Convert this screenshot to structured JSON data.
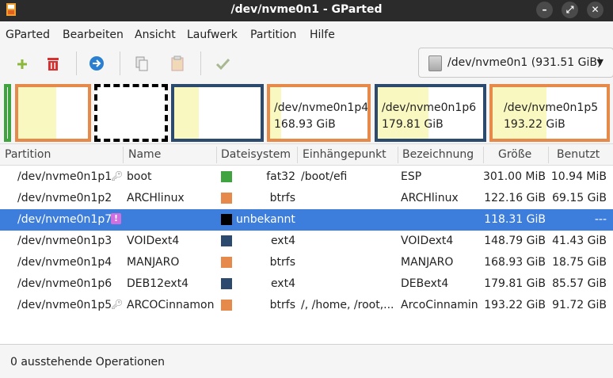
{
  "window": {
    "title": "/dev/nvme0n1 - GParted"
  },
  "menu": [
    "GParted",
    "Bearbeiten",
    "Ansicht",
    "Laufwerk",
    "Partition",
    "Hilfe"
  ],
  "device_selector": {
    "label": "/dev/nvme0n1 (931.51 GiB)"
  },
  "diskmap": [
    {
      "label": "",
      "size": "",
      "color": "#3fa33f",
      "used": 0
    },
    {
      "label": "",
      "size": "",
      "color": "#e58a4a",
      "used": 0.58
    },
    {
      "label": "",
      "size": "",
      "color": "#000000",
      "used": 0
    },
    {
      "label": "",
      "size": "",
      "color": "#2c4a6e",
      "used": 0.28
    },
    {
      "label": "/dev/nvme0n1p4",
      "size": "168.93 GiB",
      "color": "#e58a4a",
      "used": 0.11
    },
    {
      "label": "/dev/nvme0n1p6",
      "size": "179.81 GiB",
      "color": "#2c4a6e",
      "used": 0.48
    },
    {
      "label": "/dev/nvme0n1p5",
      "size": "193.22 GiB",
      "color": "#e58a4a",
      "used": 0.47
    }
  ],
  "table": {
    "headers": [
      "Partition",
      "Name",
      "Dateisystem",
      "Einhängepunkt",
      "Bezeichnung",
      "Größe",
      "Benutzt"
    ],
    "rows": [
      {
        "partition": "/dev/nvme0n1p1",
        "icon": "key-icon",
        "name": "boot",
        "fs": "fat32",
        "fs_color": "#3fa33f",
        "mount": "/boot/efi",
        "label": "ESP",
        "size": "301.00 MiB",
        "used": "10.94 MiB",
        "selected": false
      },
      {
        "partition": "/dev/nvme0n1p2",
        "icon": "",
        "name": "ARCHlinux",
        "fs": "btrfs",
        "fs_color": "#e58a4a",
        "mount": "",
        "label": "ARCHlinux",
        "size": "122.16 GiB",
        "used": "69.15 GiB",
        "selected": false
      },
      {
        "partition": "/dev/nvme0n1p7",
        "icon": "warning-icon",
        "name": "",
        "fs": "unbekannt",
        "fs_color": "#000000",
        "mount": "",
        "label": "",
        "size": "118.31 GiB",
        "used": "---",
        "selected": true
      },
      {
        "partition": "/dev/nvme0n1p3",
        "icon": "",
        "name": "VOIDext4",
        "fs": "ext4",
        "fs_color": "#2c4a6e",
        "mount": "",
        "label": "VOIDext4",
        "size": "148.79 GiB",
        "used": "41.43 GiB",
        "selected": false
      },
      {
        "partition": "/dev/nvme0n1p4",
        "icon": "",
        "name": "MANJARO",
        "fs": "btrfs",
        "fs_color": "#e58a4a",
        "mount": "",
        "label": "MANJARO",
        "size": "168.93 GiB",
        "used": "18.75 GiB",
        "selected": false
      },
      {
        "partition": "/dev/nvme0n1p6",
        "icon": "",
        "name": "DEB12ext4",
        "fs": "ext4",
        "fs_color": "#2c4a6e",
        "mount": "",
        "label": "DEBext4",
        "size": "179.81 GiB",
        "used": "85.57 GiB",
        "selected": false
      },
      {
        "partition": "/dev/nvme0n1p5",
        "icon": "key-icon",
        "name": "ARCOCinnamon",
        "fs": "btrfs",
        "fs_color": "#e58a4a",
        "mount": "/, /home, /root,...",
        "label": "ArcoCinnamin",
        "size": "193.22 GiB",
        "used": "91.72 GiB",
        "selected": false
      }
    ]
  },
  "status": {
    "text": "0 ausstehende Operationen"
  }
}
